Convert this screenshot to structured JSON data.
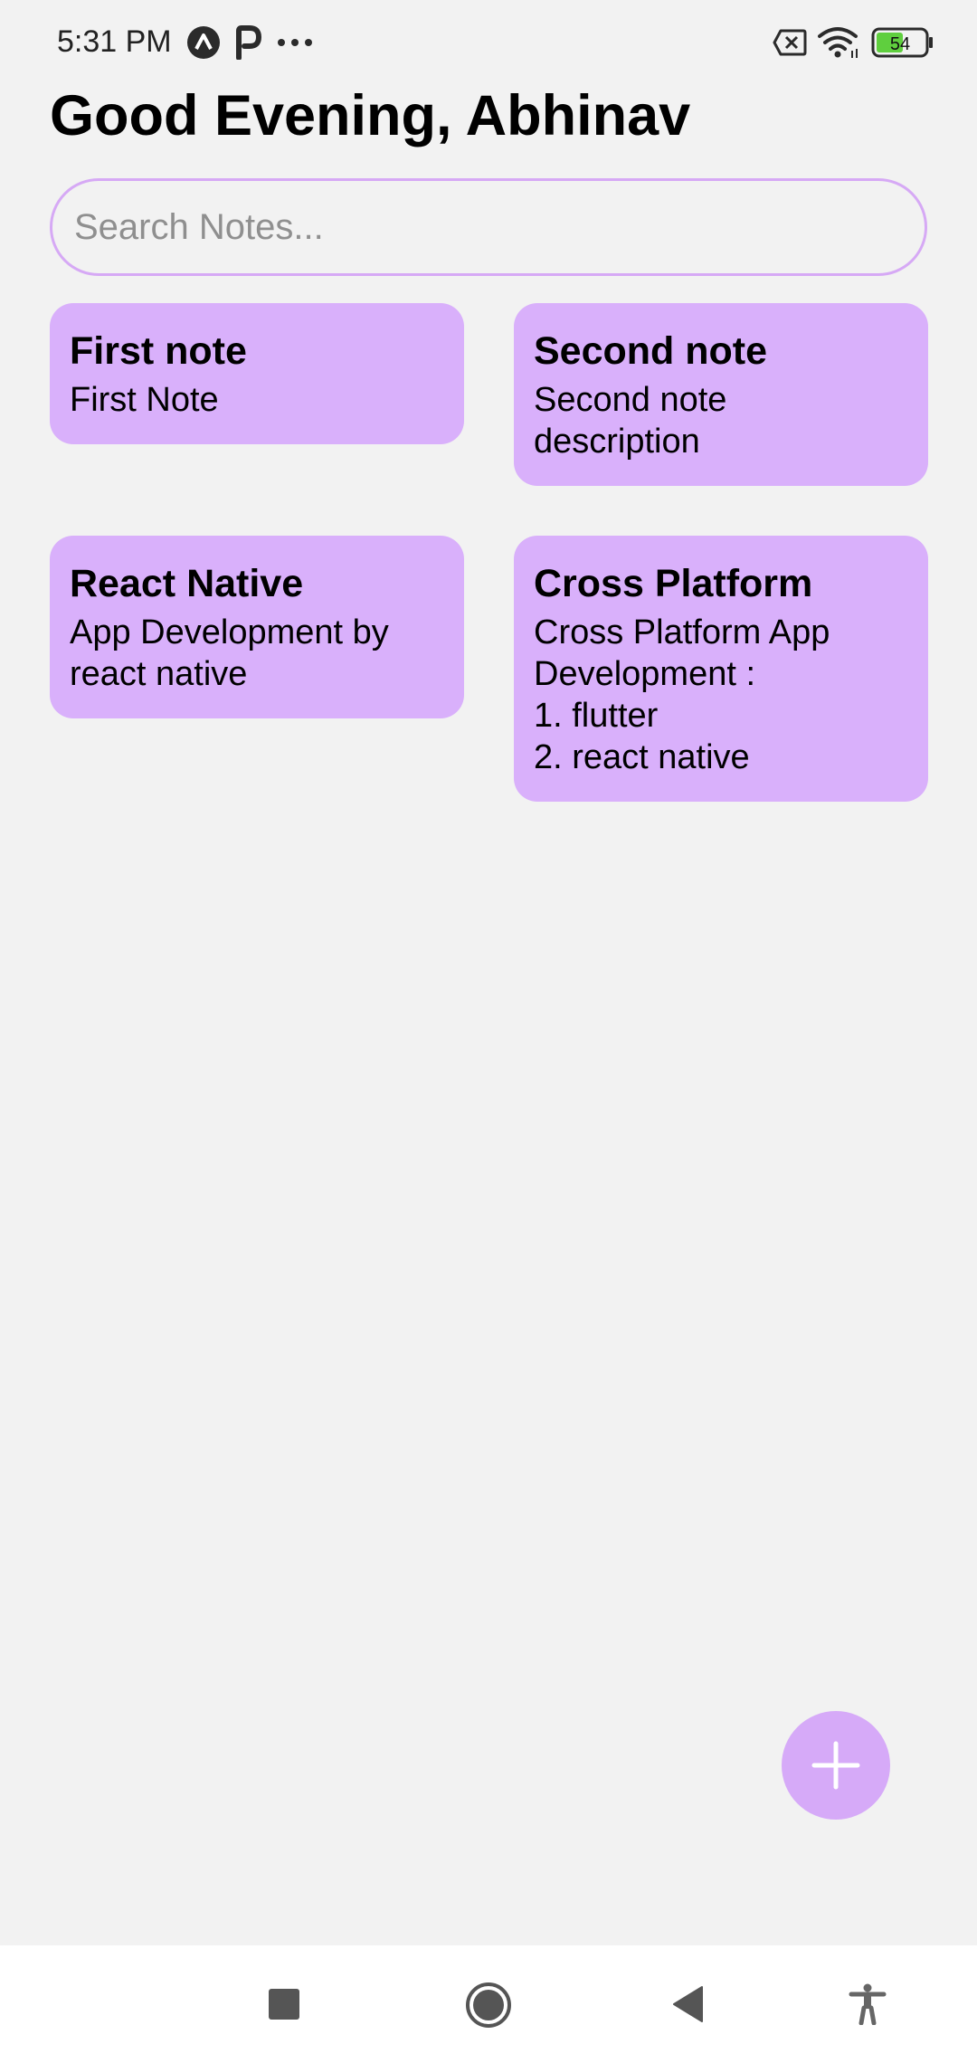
{
  "status_bar": {
    "time": "5:31 PM",
    "battery_level": "54",
    "icons": [
      "app-a-icon",
      "app-p-icon",
      "more-dots-icon",
      "sim-x-icon",
      "wifi-icon",
      "battery-icon"
    ]
  },
  "header": {
    "greeting": "Good Evening, Abhinav"
  },
  "search": {
    "placeholder": "Search Notes...",
    "value": ""
  },
  "notes": [
    {
      "title": "First note",
      "description": "First Note"
    },
    {
      "title": "Second note",
      "description": "Second note\ndescription"
    },
    {
      "title": "React Native",
      "description": "App Development by\nreact native"
    },
    {
      "title": "Cross Platform",
      "description": "Cross Platform App\nDevelopment :\n1. flutter\n2. react native"
    }
  ],
  "fab": {
    "icon": "plus-icon"
  },
  "nav_bar": {
    "icons": [
      "recents-square-icon",
      "home-circle-icon",
      "back-triangle-icon",
      "accessibility-icon"
    ]
  },
  "colors": {
    "background": "#f2f2f2",
    "card": "#d9b0fb",
    "accent": "#d6aaf8",
    "search_border": "#d6a9f5"
  }
}
